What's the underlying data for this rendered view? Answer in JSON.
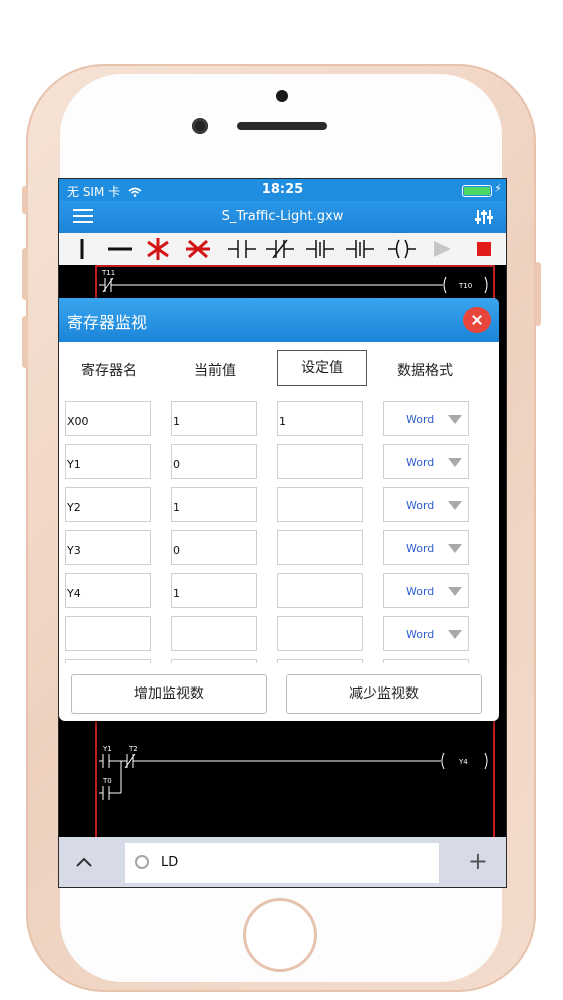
{
  "status": {
    "carrier": "无 SIM 卡",
    "time": "18:25"
  },
  "nav": {
    "title": "S_Traffic-Light.gxw"
  },
  "ladder": {
    "t11": "T11",
    "t10": "T10",
    "y1": "Y1",
    "t2": "T2",
    "t0": "T0",
    "y4": "Y4"
  },
  "dialog": {
    "title": "寄存器监视",
    "headers": [
      "寄存器名",
      "当前值",
      "设定值",
      "数据格式"
    ],
    "rows": [
      {
        "name": "X00",
        "current": "1",
        "set": "1",
        "format": "Word"
      },
      {
        "name": "Y1",
        "current": "0",
        "set": "",
        "format": "Word"
      },
      {
        "name": "Y2",
        "current": "1",
        "set": "",
        "format": "Word"
      },
      {
        "name": "Y3",
        "current": "0",
        "set": "",
        "format": "Word"
      },
      {
        "name": "Y4",
        "current": "1",
        "set": "",
        "format": "Word"
      },
      {
        "name": "",
        "current": "",
        "set": "",
        "format": "Word"
      },
      {
        "name": "",
        "current": "",
        "set": "",
        "format": ""
      }
    ],
    "add_label": "增加监视数",
    "remove_label": "减少监视数"
  },
  "bottom": {
    "search_value": "LD"
  },
  "colors": {
    "accent": "#1f8de0",
    "danger": "#e8453c",
    "ladder_red": "#c21d1d"
  }
}
